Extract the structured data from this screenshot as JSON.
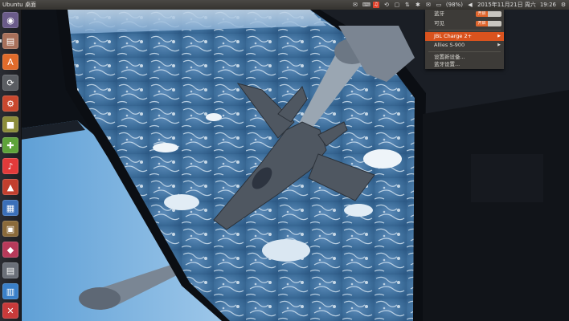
{
  "panel": {
    "title": "Ubuntu 桌面",
    "tray": {
      "battery": "(98%)",
      "datetime": "2015年11月21日 周六",
      "time": "19:26"
    }
  },
  "launcher": {
    "items": [
      {
        "name": "dash-home",
        "glyph": "◉",
        "color": "#6a5b8a"
      },
      {
        "name": "files",
        "glyph": "▤",
        "color": "#a8705a"
      },
      {
        "name": "software-center",
        "glyph": "A",
        "color": "#e06b2b"
      },
      {
        "name": "updater",
        "glyph": "⟳",
        "color": "#5a5d62"
      },
      {
        "name": "system-settings",
        "glyph": "⚙",
        "color": "#c9482e"
      },
      {
        "name": "amazon",
        "glyph": "■",
        "color": "#8c8c3a"
      },
      {
        "name": "screenshot",
        "glyph": "✚",
        "color": "#5ea33a"
      },
      {
        "name": "music",
        "glyph": "♪",
        "color": "#e23a3a"
      },
      {
        "name": "app-9",
        "glyph": "▲",
        "color": "#c23f2e"
      },
      {
        "name": "app-10",
        "glyph": "▦",
        "color": "#3a6fb8"
      },
      {
        "name": "app-11",
        "glyph": "▣",
        "color": "#8a6a3a"
      },
      {
        "name": "app-12",
        "glyph": "◆",
        "color": "#b73a5a"
      },
      {
        "name": "app-13",
        "glyph": "▤",
        "color": "#6a6f78"
      },
      {
        "name": "app-14",
        "glyph": "▥",
        "color": "#3a80c9"
      },
      {
        "name": "app-15",
        "glyph": "✕",
        "color": "#c83a3a"
      }
    ]
  },
  "bluetooth_menu": {
    "bluetooth_label": "蓝牙",
    "bluetooth_state": "开启",
    "visible_label": "可见",
    "visible_state": "开启",
    "device_1": "JBL Charge 2+",
    "device_2": "Allies S-900",
    "setup_new": "设置新设备...",
    "settings": "蓝牙设置..."
  },
  "colors": {
    "accent": "#d9531e",
    "panel": "#3d3b38"
  }
}
